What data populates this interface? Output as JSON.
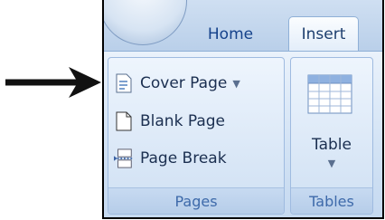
{
  "tabs": [
    {
      "label": "Home"
    },
    {
      "label": "Insert"
    }
  ],
  "groups": {
    "pages": {
      "label": "Pages",
      "commands": [
        {
          "label": "Cover Page",
          "icon": "document-icon",
          "has_dropdown": true
        },
        {
          "label": "Blank Page",
          "icon": "blank-page-icon"
        },
        {
          "label": "Page Break",
          "icon": "page-break-icon"
        }
      ]
    },
    "tables": {
      "label": "Tables",
      "command": {
        "label": "Table",
        "icon": "table-icon",
        "has_dropdown": true
      }
    }
  },
  "colors": {
    "tab_text": "#15428b",
    "group_label": "#3e6aaa",
    "ribbon_bg": "#d3e3f5"
  }
}
